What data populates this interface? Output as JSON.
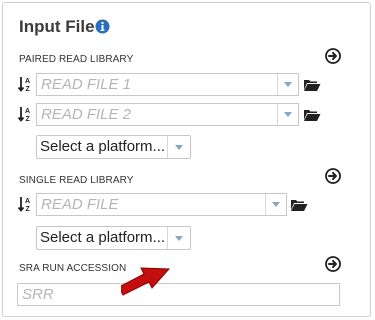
{
  "panel": {
    "title": "Input File",
    "paired": {
      "label": "PAIRED READ LIBRARY",
      "read1_placeholder": "READ FILE 1",
      "read2_placeholder": "READ FILE 2",
      "platform": "Select a platform..."
    },
    "single": {
      "label": "SINGLE READ LIBRARY",
      "read_placeholder": "READ FILE",
      "platform": "Select a platform..."
    },
    "sra": {
      "label": "SRA RUN ACCESSION",
      "placeholder": "SRR",
      "value": ""
    }
  },
  "icons": {
    "info": "info-icon",
    "add": "circle-arrow-right-icon",
    "sort": "sort-alpha-icon",
    "folder": "folder-open-icon",
    "annotation": "red-arrow-icon"
  },
  "colors": {
    "info_blue": "#2a6ebb",
    "arrow_red": "#c40d0d"
  }
}
